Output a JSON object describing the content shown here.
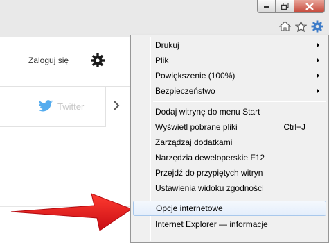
{
  "window": {
    "minimize_icon": "minimize-icon",
    "restore_icon": "restore-icon",
    "close_icon": "close-icon"
  },
  "command_bar": {
    "icons": [
      "home-icon",
      "favorites-star-icon",
      "tools-gear-icon"
    ]
  },
  "page": {
    "login_label": "Zaloguj się",
    "twitter_label": "Twitter"
  },
  "menu": {
    "items": [
      {
        "label": "Drukuj",
        "submenu": true
      },
      {
        "label": "Plik",
        "submenu": true
      },
      {
        "label": "Powiększenie (100%)",
        "submenu": true
      },
      {
        "label": "Bezpieczeństwo",
        "submenu": true
      },
      {
        "label": "Dodaj witrynę do menu Start"
      },
      {
        "label": "Wyświetl pobrane pliki",
        "shortcut": "Ctrl+J"
      },
      {
        "label": "Zarządzaj dodatkami"
      },
      {
        "label": "Narzędzia deweloperskie F12"
      },
      {
        "label": "Przejdź do przypiętych witryn"
      },
      {
        "label": "Ustawienia widoku zgodności"
      },
      {
        "label": "Opcje internetowe",
        "highlighted": true
      },
      {
        "label": "Internet Explorer — informacje"
      }
    ]
  },
  "colors": {
    "accent_arrow": "#e8141c",
    "twitter_blue": "#55acee",
    "menu_highlight_border": "#a8c8ec"
  }
}
